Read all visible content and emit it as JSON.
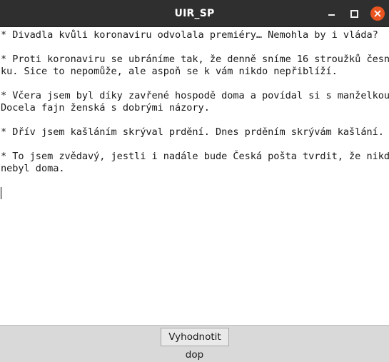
{
  "window": {
    "title": "UIR_SP"
  },
  "editor": {
    "text": "* Divadla kvůli koronaviru odvolala premiéry… Nemohla by i vláda?\n\n* Proti koronaviru se ubráníme tak, že denně sníme 16 stroužků česne\nku. Sice to nepomůže, ale aspoň se k vám nikdo nepřiblíží.\n\n* Včera jsem byl díky zavřené hospodě doma a povídal si s manželkou.\nDocela fajn ženská s dobrými názory.\n\n* Dřív jsem kašláním skrýval prdění. Dnes prděním skrývám kašlání.\n\n* To jsem zvědavý, jestli i nadále bude Česká pošta tvrdit, že nikdo\nnebyl doma.\n"
  },
  "bottom_panel": {
    "button_label": "Vyhodnotit",
    "result_label": "dop"
  },
  "icons": {
    "minimize": "minimize-icon",
    "maximize": "maximize-icon",
    "close": "close-icon"
  },
  "colors": {
    "titlebar": "#2f2f2f",
    "close_button": "#e95420",
    "panel": "#d9d9d9"
  }
}
